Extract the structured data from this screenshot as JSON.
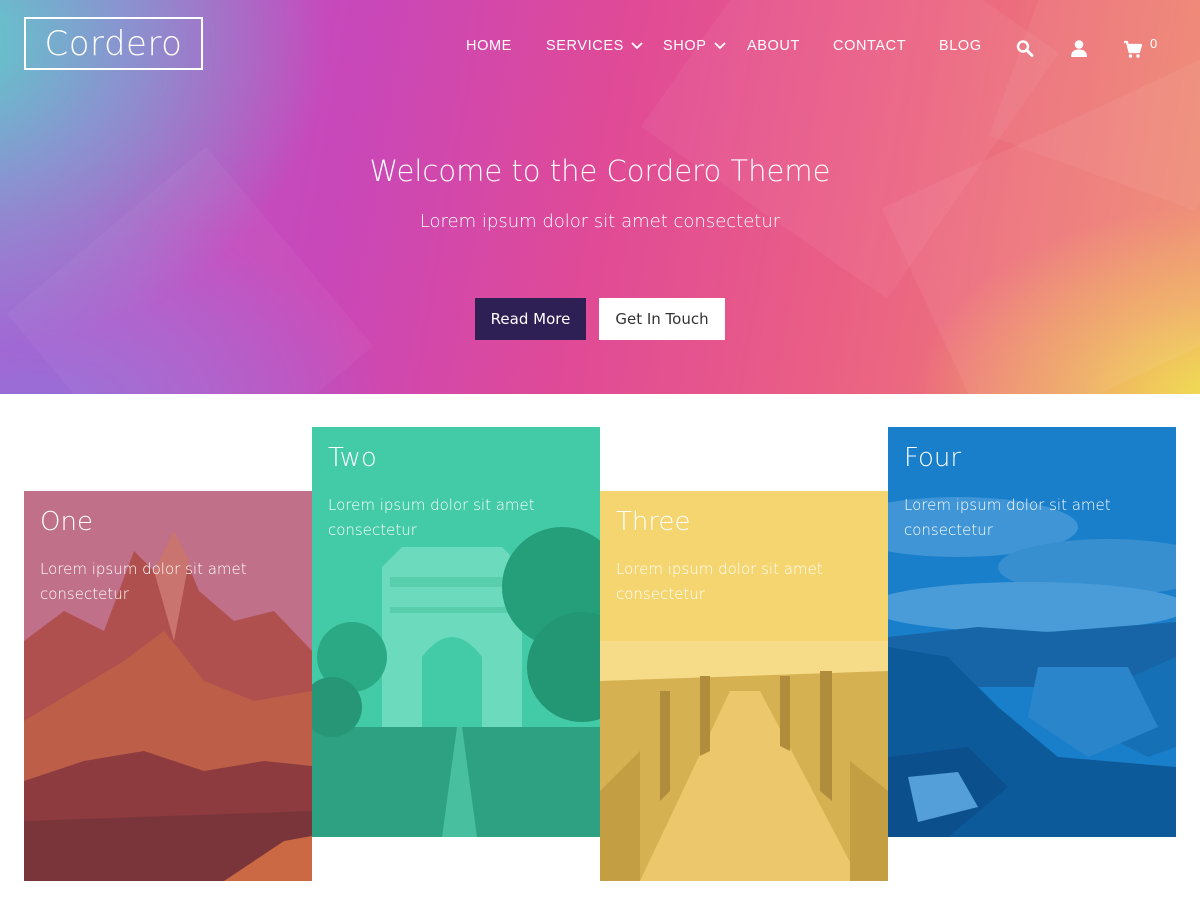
{
  "site": {
    "logo": "Cordero"
  },
  "nav": {
    "items": [
      {
        "label": "HOME"
      },
      {
        "label": "SERVICES"
      },
      {
        "label": "SHOP"
      },
      {
        "label": "ABOUT"
      },
      {
        "label": "CONTACT"
      },
      {
        "label": "BLOG"
      }
    ],
    "icons": [
      "search-icon",
      "user-icon",
      "cart-icon",
      "chevron-down-icon"
    ],
    "cart_count": "0"
  },
  "hero": {
    "title": "Welcome to the Cordero Theme",
    "subtitle": "Lorem ipsum dolor sit amet consectetur",
    "primary_button": "Read More",
    "secondary_button": "Get In Touch"
  },
  "cards": [
    {
      "title": "One",
      "text": "Lorem ipsum dolor sit amet consectetur",
      "tint": "#b24a6a"
    },
    {
      "title": "Two",
      "text": "Lorem ipsum dolor sit amet consectetur",
      "tint": "#2fc4a0"
    },
    {
      "title": "Three",
      "text": "Lorem ipsum dolor sit amet consectetur",
      "tint": "#f3cd5e"
    },
    {
      "title": "Four",
      "text": "Lorem ipsum dolor sit amet consectetur",
      "tint": "#0f74c4"
    }
  ],
  "colors": {
    "primary_button_bg": "#2e1f55",
    "hero_gradient": [
      "#5ad2c8",
      "#c947b8",
      "#e04a96",
      "#f0e850"
    ]
  }
}
